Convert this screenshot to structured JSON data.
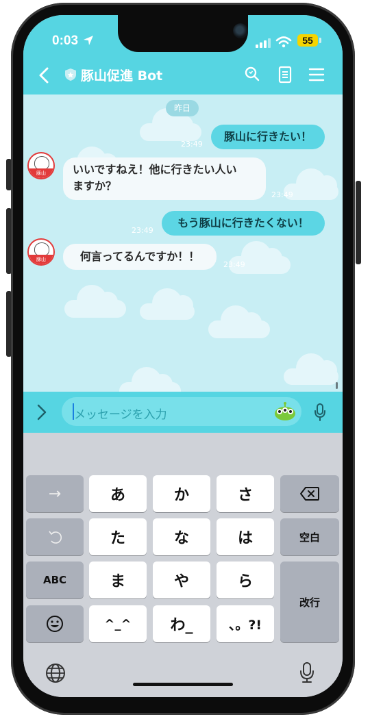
{
  "status_bar": {
    "time": "0:03",
    "battery": "55"
  },
  "header": {
    "title": "豚山促進 Bot"
  },
  "chat": {
    "date_chip": "昨日",
    "messages": [
      {
        "from": "me",
        "text": "豚山に行きたい！",
        "time": "23:49"
      },
      {
        "from": "bot",
        "text_line1": "いいですねえ！他に行きたい人い",
        "text_line2": "ますか？",
        "time": "23:49"
      },
      {
        "from": "me",
        "text": "もう豚山に行きたくない！",
        "time": "23:49"
      },
      {
        "from": "bot",
        "text": "何言ってるんですか！！",
        "time": "23:49"
      }
    ],
    "avatar_label": "豚山"
  },
  "input": {
    "placeholder": "メッセージを入力"
  },
  "keyboard": {
    "row1": [
      "→",
      "あ",
      "か",
      "さ"
    ],
    "row2": [
      "た",
      "な",
      "は"
    ],
    "space": "空白",
    "abc": "ABC",
    "row3": [
      "ま",
      "や",
      "ら"
    ],
    "enter": "改行",
    "row4": [
      "^_^",
      "わ_",
      "、。?!"
    ]
  },
  "colors": {
    "accent": "#56d5e2",
    "chat_background": "#c8eef4",
    "my_bubble": "#5cd6e4",
    "bot_bubble": "#f3f9fb",
    "battery": "#f5d400"
  }
}
